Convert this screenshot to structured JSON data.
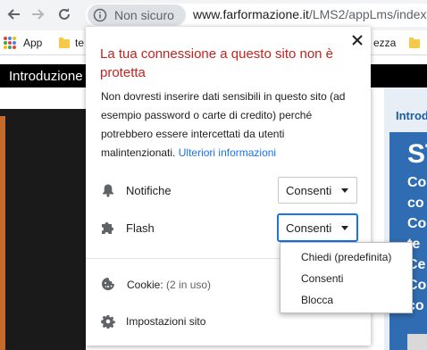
{
  "browser": {
    "security_chip_label": "Non sicuro",
    "url_host": "www.farformazione.it",
    "url_path": "/LMS2/appLms/index"
  },
  "bookmarks": {
    "items": [
      {
        "label": "App"
      },
      {
        "label": "te"
      },
      {
        "label": "ezza"
      }
    ]
  },
  "page": {
    "header_text": "Introduzione",
    "right_title": "Introd",
    "right_big": "ST",
    "right_lines": [
      "Co",
      "co",
      "Co",
      "te",
      "Ce",
      "Co",
      "co"
    ]
  },
  "popup": {
    "title": "La tua connessione a questo sito non è protetta",
    "description": "Non dovresti inserire dati sensibili in questo sito (ad esempio password o carte di credito) perché potrebbero essere intercettati da utenti malintenzionati.",
    "learn_more": "Ulteriori informazioni",
    "permissions": [
      {
        "label": "Notifiche",
        "value": "Consenti",
        "icon": "bell-icon"
      },
      {
        "label": "Flash",
        "value": "Consenti",
        "icon": "puzzle-icon"
      }
    ],
    "cookie_label": "Cookie:",
    "cookie_count": "(2 in uso)",
    "site_settings_label": "Impostazioni sito"
  },
  "dropdown": {
    "options": [
      "Chiedi (predefinita)",
      "Consenti",
      "Blocca"
    ]
  },
  "colors": {
    "warning_red": "#c5221f",
    "link_blue": "#1a73e8",
    "page_blue": "#2f6cb1"
  }
}
